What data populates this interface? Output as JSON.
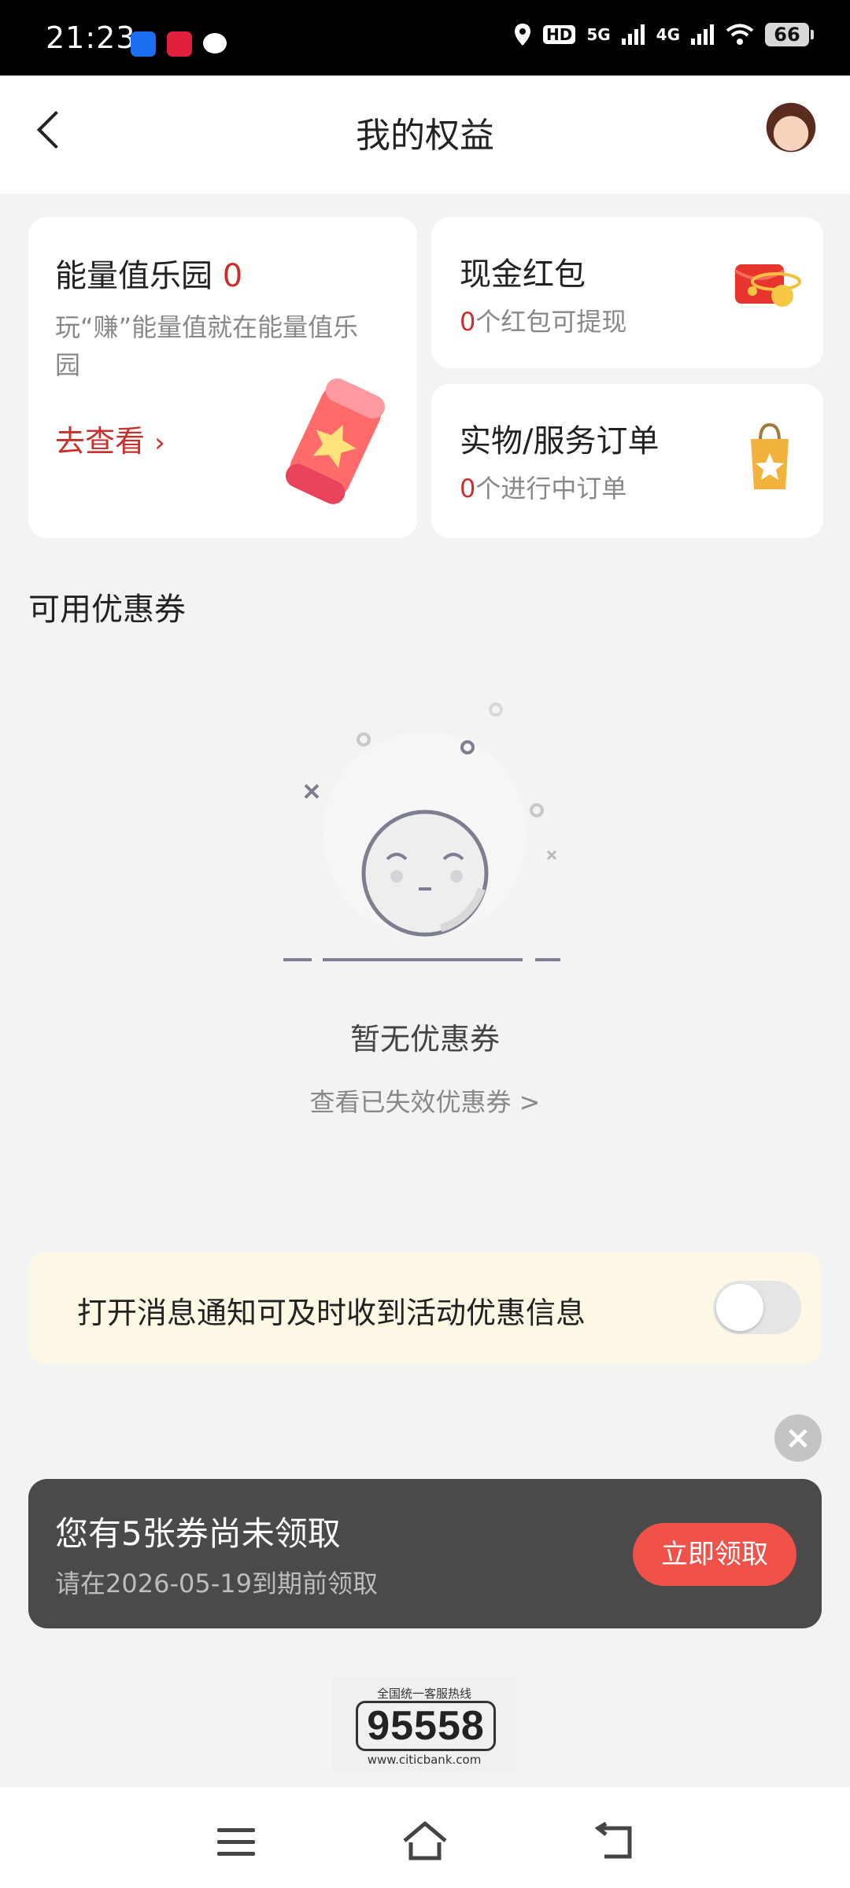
{
  "status_bar": {
    "time": "21:23",
    "network_1": "5G",
    "network_2": "4G",
    "battery": "66"
  },
  "header": {
    "title": "我的权益"
  },
  "energy_card": {
    "title": "能量值乐园",
    "count": "0",
    "desc": "玩“赚”能量值就在能量值乐园",
    "link": "去查看"
  },
  "cash_card": {
    "title": "现金红包",
    "count": "0",
    "desc": "个红包可提现"
  },
  "order_card": {
    "title": "实物/服务订单",
    "count": "0",
    "desc": "个进行中订单"
  },
  "coupons": {
    "section_title": "可用优惠券",
    "empty_text": "暂无优惠券",
    "expired_link": "查看已失效优惠券 >"
  },
  "notification": {
    "text": "打开消息通知可及时收到活动优惠信息",
    "enabled": false
  },
  "banner": {
    "title": "您有5张券尚未领取",
    "subtitle": "请在2026-05-19到期前领取",
    "button": "立即领取"
  },
  "hotline": {
    "caption": "全国统一客服热线",
    "number": "95558",
    "url": "www.citicbank.com"
  },
  "colors": {
    "accent": "#c9302c",
    "button": "#f0524a",
    "banner_bg": "#4a4a4a",
    "notify_bg": "#fdf8e6"
  }
}
